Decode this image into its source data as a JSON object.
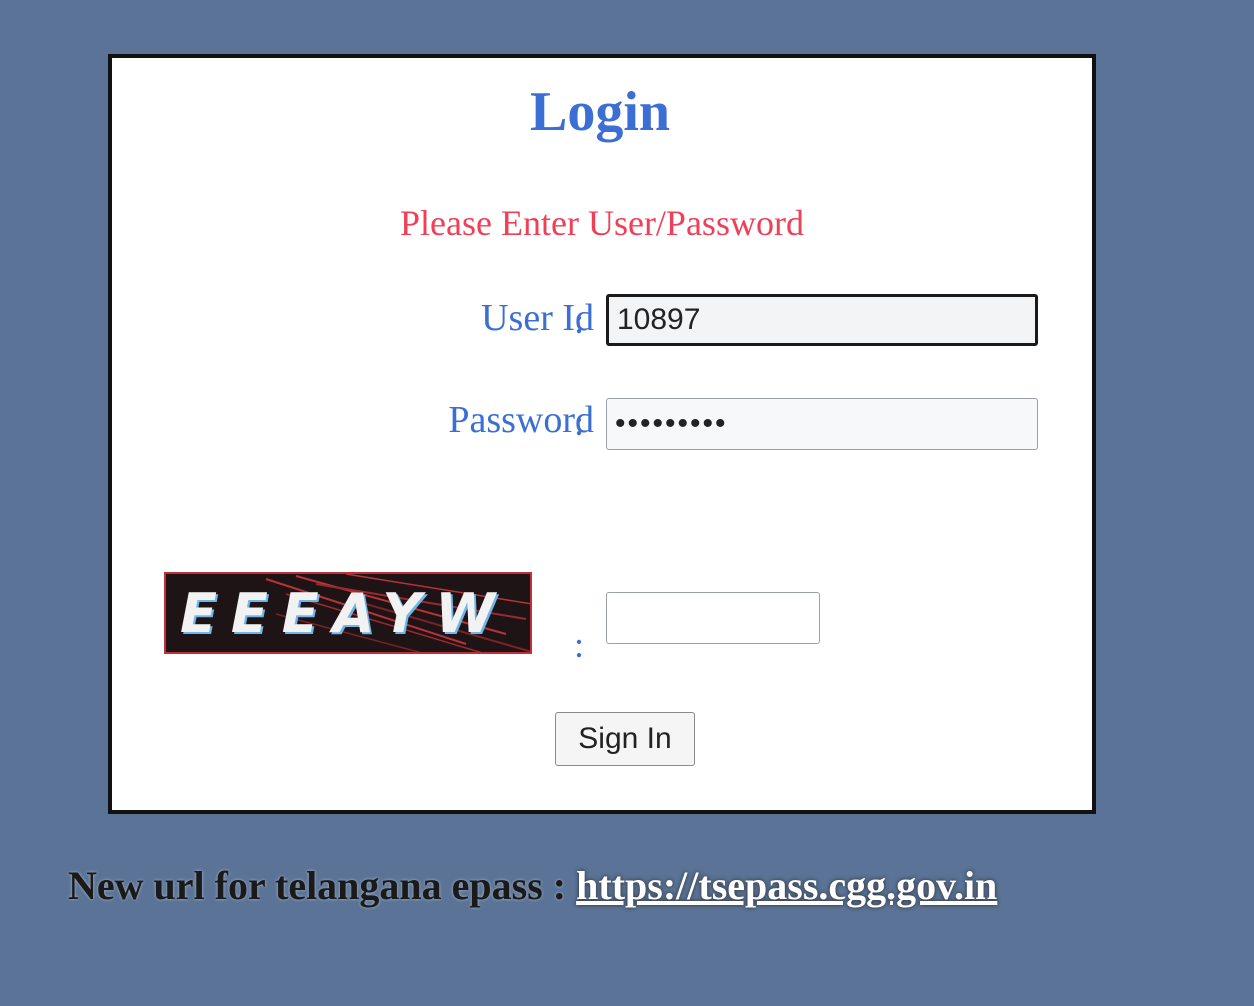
{
  "login": {
    "title": "Login",
    "message": "Please Enter User/Password",
    "userid_label": "User Id",
    "userid_value": "10897",
    "password_label": "Password",
    "password_value": "•••••••••",
    "colon": ":",
    "captcha_text": "EEEAYW",
    "captcha_value": "",
    "signin_label": "Sign In"
  },
  "footer": {
    "text": "New url for telangana epass : ",
    "link": "https://tsepass.cgg.gov.in"
  },
  "colors": {
    "background": "#5a7396",
    "title": "#3b6fd4",
    "message": "#ee4057",
    "label": "#3b6fd4"
  }
}
